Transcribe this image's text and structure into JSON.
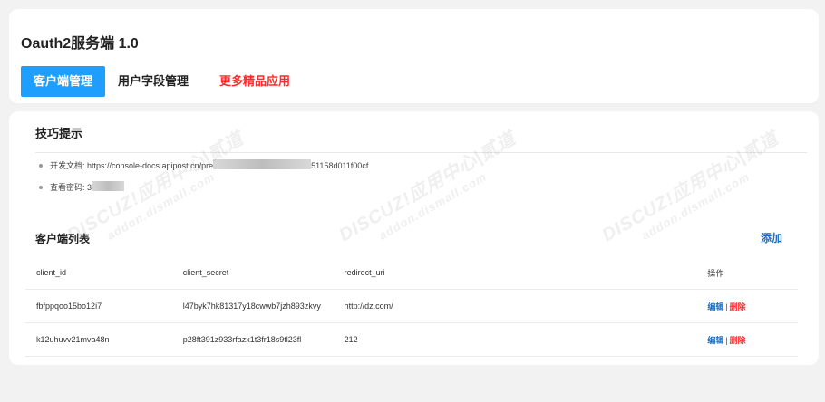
{
  "header": {
    "app_title": "Oauth2服务端 1.0",
    "tabs": [
      {
        "label": "客户端管理",
        "active": true
      },
      {
        "label": "用户字段管理",
        "active": false
      },
      {
        "label": "更多精品应用",
        "active": false,
        "highlight": true
      }
    ]
  },
  "tips": {
    "title": "技巧提示",
    "items": [
      {
        "prefix": "开发文档: https://console-docs.apipost.cn/pre",
        "suffix": "51158d011f00cf"
      },
      {
        "prefix": "查看密码: 3",
        "suffix": ""
      }
    ]
  },
  "client_list": {
    "title": "客户端列表",
    "add_label": "添加",
    "columns": [
      "client_id",
      "client_secret",
      "redirect_uri",
      "操作"
    ],
    "rows": [
      {
        "client_id": "fbfppqoo15bo12i7",
        "client_secret": "l47byk7hk81317y18cwwb7jzh893zkvy",
        "redirect_uri": "http://dz.com/"
      },
      {
        "client_id": "k12uhuvv21mva48n",
        "client_secret": "p28ft391z933rfazx1t3fr18s9tl23fl",
        "redirect_uri": "212"
      }
    ],
    "actions": {
      "edit": "编辑",
      "separator": "|",
      "delete": "删除"
    }
  },
  "watermark": {
    "line1": "DISCUZ!应用中心|贰道",
    "line2": "addon.dismall.com"
  },
  "colors": {
    "accent": "#1e9fff",
    "link": "#1e6fbf",
    "danger": "#ff2a2a",
    "background": "#f2f2f2"
  }
}
